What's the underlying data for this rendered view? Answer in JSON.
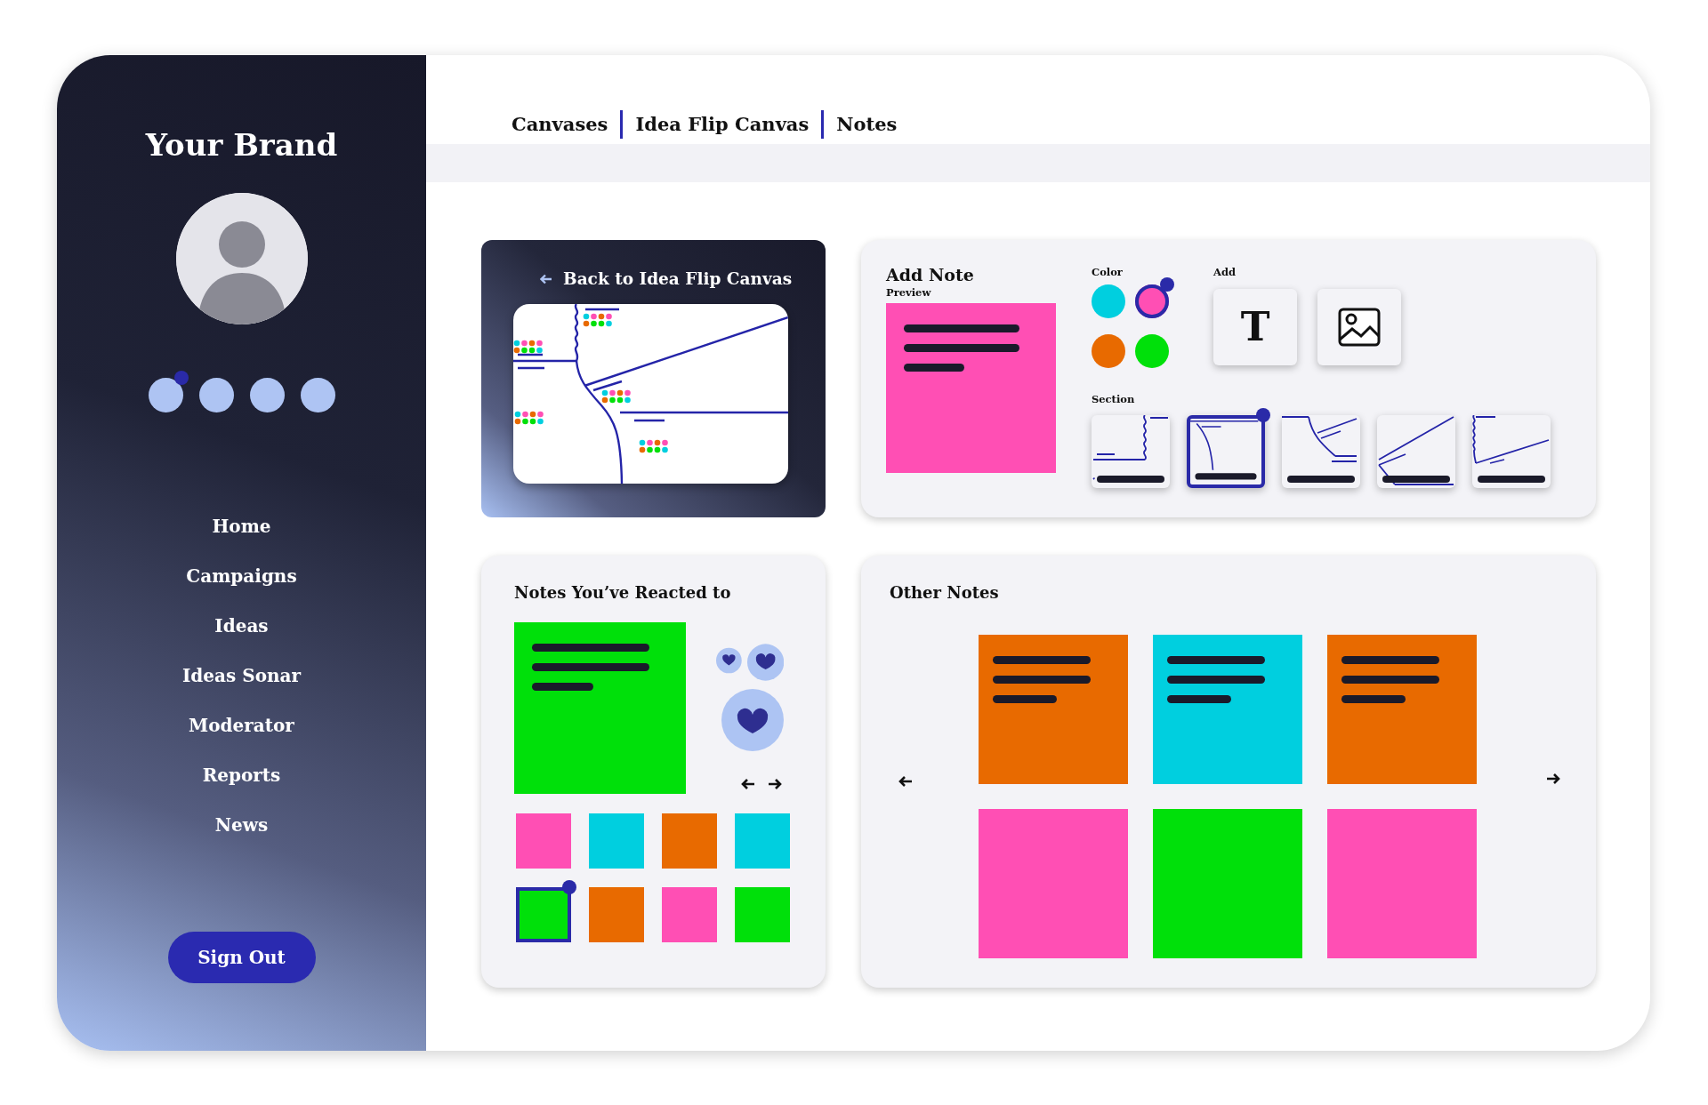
{
  "sidebar": {
    "brand": "Your Brand",
    "pager_dots": [
      {
        "selected": true
      },
      {
        "selected": false
      },
      {
        "selected": false
      },
      {
        "selected": false
      }
    ],
    "nav": [
      "Home",
      "Campaigns",
      "Ideas",
      "Ideas Sonar",
      "Moderator",
      "Reports",
      "News"
    ],
    "sign_out": "Sign Out"
  },
  "breadcrumbs": [
    "Canvases",
    "Idea Flip Canvas",
    "Notes"
  ],
  "canvas_card": {
    "back_label": "Back to Idea Flip Canvas"
  },
  "add_note": {
    "title": "Add Note",
    "preview_label": "Preview",
    "color_label": "Color",
    "colors": [
      {
        "color": "#00cfdf",
        "selected": false
      },
      {
        "color": "#ff4fb4",
        "selected": true
      },
      {
        "color": "#e86a00",
        "selected": false
      },
      {
        "color": "#00e00a",
        "selected": false
      }
    ],
    "add_label": "Add",
    "add_options": [
      {
        "kind": "text",
        "label": "T"
      },
      {
        "kind": "image"
      }
    ],
    "section_label": "Section",
    "sections": [
      {
        "kind": "wave-corner",
        "selected": false
      },
      {
        "kind": "curve",
        "selected": true
      },
      {
        "kind": "fork",
        "selected": false
      },
      {
        "kind": "diagonal",
        "selected": false
      },
      {
        "kind": "wave-diagonal",
        "selected": false
      }
    ]
  },
  "reacted": {
    "title": "Notes You’ve Reacted to",
    "featured": {
      "color": "#00e00a"
    },
    "notes": [
      {
        "color": "#ff4fb4",
        "selected": false
      },
      {
        "color": "#00cfdf",
        "selected": false
      },
      {
        "color": "#e86a00",
        "selected": false
      },
      {
        "color": "#00cfdf",
        "selected": false
      },
      {
        "color": "#00e00a",
        "selected": true
      },
      {
        "color": "#e86a00",
        "selected": false
      },
      {
        "color": "#ff4fb4",
        "selected": false
      },
      {
        "color": "#00e00a",
        "selected": false
      }
    ]
  },
  "other_notes": {
    "title": "Other Notes",
    "notes": [
      {
        "color": "#e86a00",
        "lines": true
      },
      {
        "color": "#00cfdf",
        "lines": true
      },
      {
        "color": "#e86a00",
        "lines": true
      },
      {
        "color": "#ff4fb4",
        "lines": false
      },
      {
        "color": "#00e00a",
        "lines": false
      },
      {
        "color": "#ff4fb4",
        "lines": false
      }
    ]
  }
}
